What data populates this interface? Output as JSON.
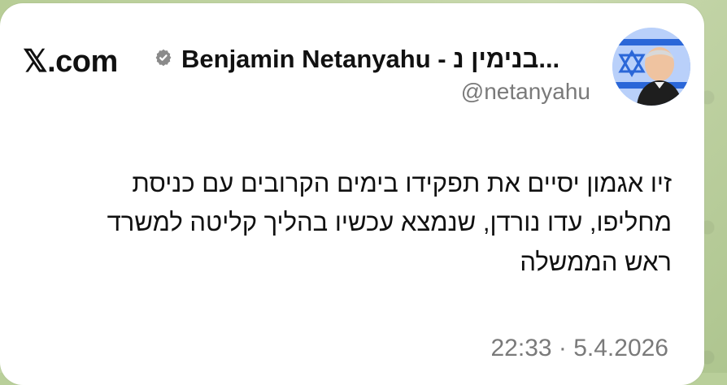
{
  "brand": {
    "label": "𝕏.com",
    "icon": "x-logo-icon"
  },
  "profile": {
    "name": "Benjamin Netanyahu - בנימין נ...",
    "handle": "@netanyahu",
    "verified_icon": "verified-badge-icon",
    "avatar": "avatar"
  },
  "post": {
    "text": "זיו אגמון יסיים את תפקידו בימים הקרובים עם כניסת\nמחליפו, עדו נורדן, שנמצא עכשיו בהליך קליטה למשרד\nראש הממשלה",
    "timestamp": "22:33 · 5.4.2026"
  },
  "colors": {
    "background": "#b9cf9a",
    "card": "#ffffff",
    "text": "#111111",
    "muted": "#7a7a7a"
  }
}
